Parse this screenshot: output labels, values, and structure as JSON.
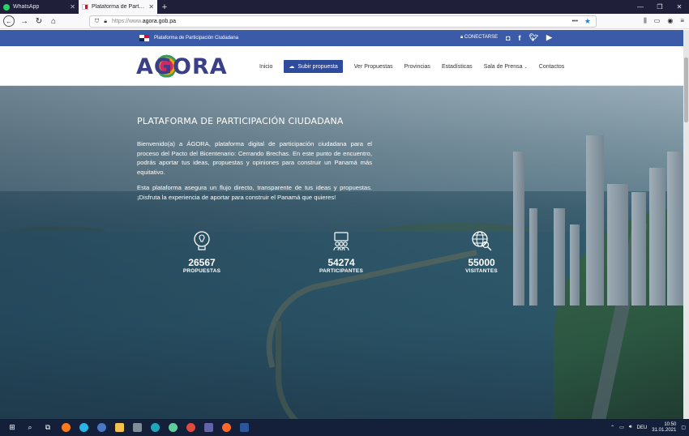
{
  "browser": {
    "tabs": [
      {
        "title": "WhatsApp",
        "icon": "whatsapp-icon"
      },
      {
        "title": "Plataforma de Participación C",
        "icon": "gov-favicon-icon"
      }
    ],
    "url_protocol": "https://www.",
    "url_host": "agora.gob.pa",
    "url_more": "•••",
    "window_controls": [
      "—",
      "❐",
      "✕"
    ],
    "nav_icons": [
      "back-icon",
      "forward-icon",
      "reload-icon",
      "home-icon"
    ]
  },
  "site": {
    "topbar": {
      "platform_label": "Plataforma de Participación Ciudadana",
      "login_label": "CONECTARSE",
      "social": [
        "instagram-icon",
        "facebook-icon",
        "twitter-icon",
        "youtube-icon"
      ]
    },
    "logo_text": "AGORA",
    "menu": {
      "inicio": "Inicio",
      "subir": "Subir propuesta",
      "ver": "Ver Propuestas",
      "provincias": "Provincias",
      "estadisticas": "Estadísticas",
      "prensa": "Sala de Prensa",
      "contactos": "Contactos"
    },
    "hero": {
      "title": "PLATAFORMA DE PARTICIPACIÓN CIUDADANA",
      "p1": "Bienvenido(a) a ÁGORA, plataforma digital de participación ciudadana para el proceso del Pacto del Bicentenario: Cerrando Brechas. En este punto de encuentro, podrás aportar tus ideas, propuestas y opiniones para construir un Panamá más equitativo.",
      "p2": "Esta plataforma asegura un flujo directo, transparente de tus ideas y propuestas. ¡Disfruta la experiencia de aportar para construir el Panamá que quieres!"
    },
    "stats": [
      {
        "value": "26567",
        "label": "PROPUESTAS",
        "icon": "lightbulb-head-icon"
      },
      {
        "value": "54274",
        "label": "PARTICIPANTES",
        "icon": "people-icon"
      },
      {
        "value": "55000",
        "label": "VISITANTES",
        "icon": "globe-search-icon"
      }
    ]
  },
  "taskbar": {
    "lang": "DEU",
    "time": "10:50",
    "date": "31.01.2021"
  },
  "colors": {
    "topstrip": "#3b5ba8",
    "button": "#2f4b9b",
    "logo": "#3b3f86"
  }
}
